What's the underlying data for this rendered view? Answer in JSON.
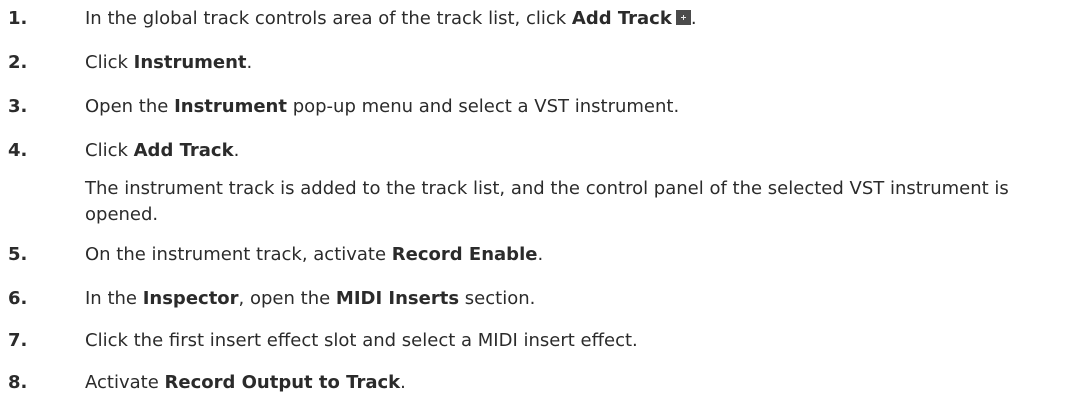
{
  "steps": [
    {
      "number": "1.",
      "before": "In the global track controls area of the track list, click ",
      "bold": "Add Track",
      "icon": "add-track-icon",
      "after": "."
    },
    {
      "number": "2.",
      "before": "Click ",
      "bold": "Instrument",
      "after": "."
    },
    {
      "number": "3.",
      "before": "Open the ",
      "bold": "Instrument",
      "after": " pop-up menu and select a VST instrument."
    },
    {
      "number": "4.",
      "before": "Click ",
      "bold": "Add Track",
      "after": ".",
      "result": "The instrument track is added to the track list, and the control panel of the selected VST instrument is opened."
    },
    {
      "number": "5.",
      "before": "On the instrument track, activate ",
      "bold": "Record Enable",
      "after": "."
    },
    {
      "number": "6.",
      "before": "In the ",
      "bold": "Inspector",
      "middle": ", open the ",
      "bold2": "MIDI Inserts",
      "after": " section."
    },
    {
      "number": "7.",
      "before": "Click the first insert effect slot and select a MIDI insert effect."
    },
    {
      "number": "8.",
      "before": "Activate ",
      "bold": "Record Output to Track",
      "after": "."
    }
  ]
}
